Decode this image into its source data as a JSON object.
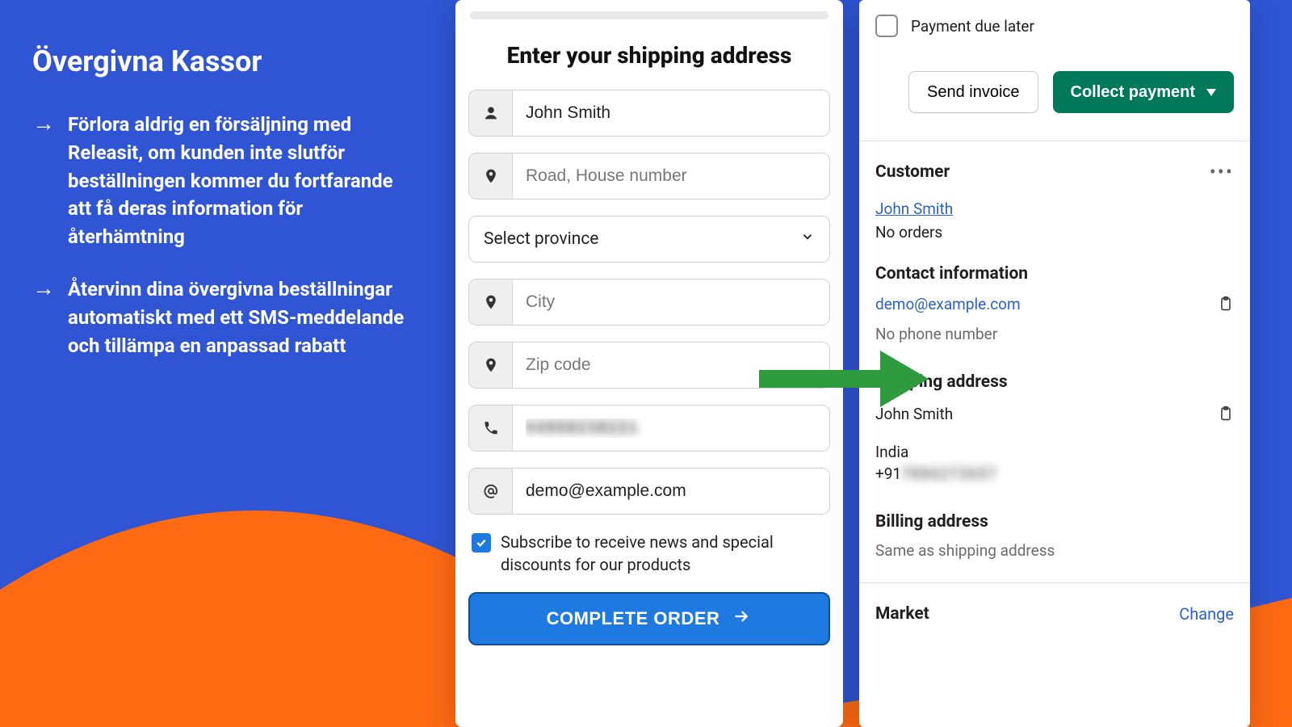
{
  "left": {
    "title": "Övergivna Kassor",
    "bullets": [
      "Förlora aldrig en försäljning med Releasit, om kunden inte slutför beställningen kommer du fortfarande att få deras information för återhämtning",
      "Återvinn dina övergivna beställningar automatiskt med ett SMS-meddelande och tillämpa en anpassad rabatt"
    ]
  },
  "form": {
    "heading": "Enter your shipping address",
    "name_value": "John Smith",
    "address_placeholder": "Road, House number",
    "province_label": "Select province",
    "city_placeholder": "City",
    "zip_placeholder": "Zip code",
    "phone_value_masked": "04958238221",
    "email_value": "demo@example.com",
    "subscribe_label": "Subscribe to receive news and special discounts for our products",
    "submit_label": "COMPLETE ORDER"
  },
  "admin": {
    "payment_due_label": "Payment due later",
    "send_invoice_label": "Send invoice",
    "collect_payment_label": "Collect payment",
    "customer": {
      "heading": "Customer",
      "name": "John Smith",
      "orders": "No orders"
    },
    "contact": {
      "heading": "Contact information",
      "email": "demo@example.com",
      "phone_placeholder": "No phone number"
    },
    "shipping": {
      "heading": "Shipping address",
      "name": "John Smith",
      "country": "India",
      "phone_prefix": "+91",
      "phone_masked": "7886273657"
    },
    "billing": {
      "heading": "Billing address",
      "text": "Same as shipping address"
    },
    "market": {
      "heading": "Market",
      "change_label": "Change"
    }
  }
}
